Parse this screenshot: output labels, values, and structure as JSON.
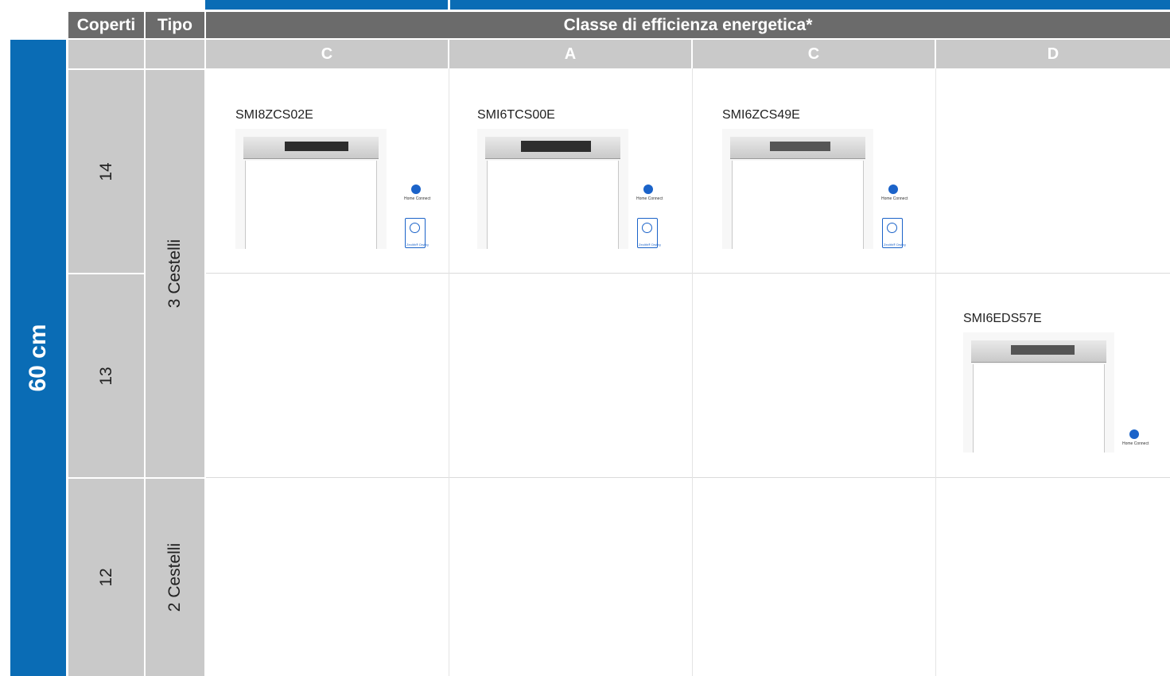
{
  "header": {
    "coperti_label": "Coperti",
    "tipo_label": "Tipo",
    "class_title": "Classe di efficienza energetica*"
  },
  "energy_classes": [
    "C",
    "A",
    "C",
    "D"
  ],
  "width_label": "60 cm",
  "rows": [
    {
      "coperti": "14"
    },
    {
      "coperti": "13"
    },
    {
      "coperti": "12"
    }
  ],
  "tipo": [
    {
      "label": "3 Cestelli"
    },
    {
      "label": "2 Cestelli"
    }
  ],
  "products": [
    {
      "model": "SMI8ZCS02E",
      "homeconnect": "Home Connect",
      "zeolith": "Zeolith® Drying"
    },
    {
      "model": "SMI6TCS00E",
      "homeconnect": "Home Connect",
      "zeolith": "Zeolith® Drying"
    },
    {
      "model": "SMI6ZCS49E",
      "homeconnect": "Home Connect",
      "zeolith": "Zeolith® Drying"
    },
    {
      "model": "SMI6EDS57E",
      "homeconnect": "Home Connect"
    }
  ],
  "colors": {
    "bosch_blue": "#0a6cb5",
    "header_gray": "#6b6b6b",
    "light_gray": "#c9c9c9",
    "icon_blue": "#1b63c9"
  }
}
